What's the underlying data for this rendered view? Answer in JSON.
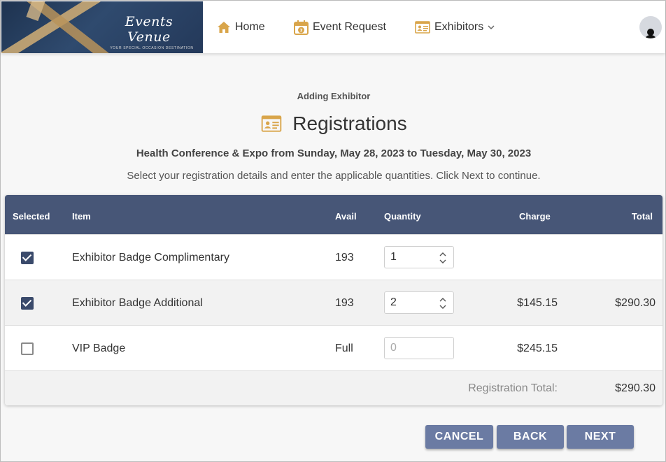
{
  "header": {
    "logo_text": "Events Venue",
    "logo_tagline": "YOUR SPECIAL OCCASION DESTINATION",
    "nav": [
      {
        "label": "Home",
        "icon": "home-icon"
      },
      {
        "label": "Event Request",
        "icon": "calendar-question-icon"
      },
      {
        "label": "Exhibitors",
        "icon": "id-card-icon",
        "has_dropdown": true
      }
    ]
  },
  "page": {
    "subtitle": "Adding Exhibitor",
    "title": "Registrations",
    "event_line": "Health Conference & Expo from Sunday, May 28, 2023 to Tuesday, May 30, 2023",
    "instructions": "Select your registration details and enter the applicable quantities. Click Next to continue."
  },
  "table": {
    "columns": [
      "Selected",
      "Item",
      "Avail",
      "Quantity",
      "Charge",
      "Total"
    ],
    "rows": [
      {
        "selected": true,
        "item": "Exhibitor Badge Complimentary",
        "avail": "193",
        "quantity": "1",
        "charge": "",
        "total": ""
      },
      {
        "selected": true,
        "item": "Exhibitor Badge Additional",
        "avail": "193",
        "quantity": "2",
        "charge": "$145.15",
        "total": "$290.30"
      },
      {
        "selected": false,
        "item": "VIP Badge",
        "avail": "Full",
        "quantity": "",
        "quantity_placeholder": "0",
        "charge": "$245.15",
        "total": ""
      }
    ],
    "footer": {
      "label": "Registration Total:",
      "total": "$290.30"
    }
  },
  "buttons": {
    "cancel": "CANCEL",
    "back": "BACK",
    "next": "NEXT"
  },
  "colors": {
    "header_bg": "#475677",
    "button_bg": "#6b7ba3",
    "icon_gold": "#d9a54a",
    "checkbox_on": "#3a4a6b"
  }
}
